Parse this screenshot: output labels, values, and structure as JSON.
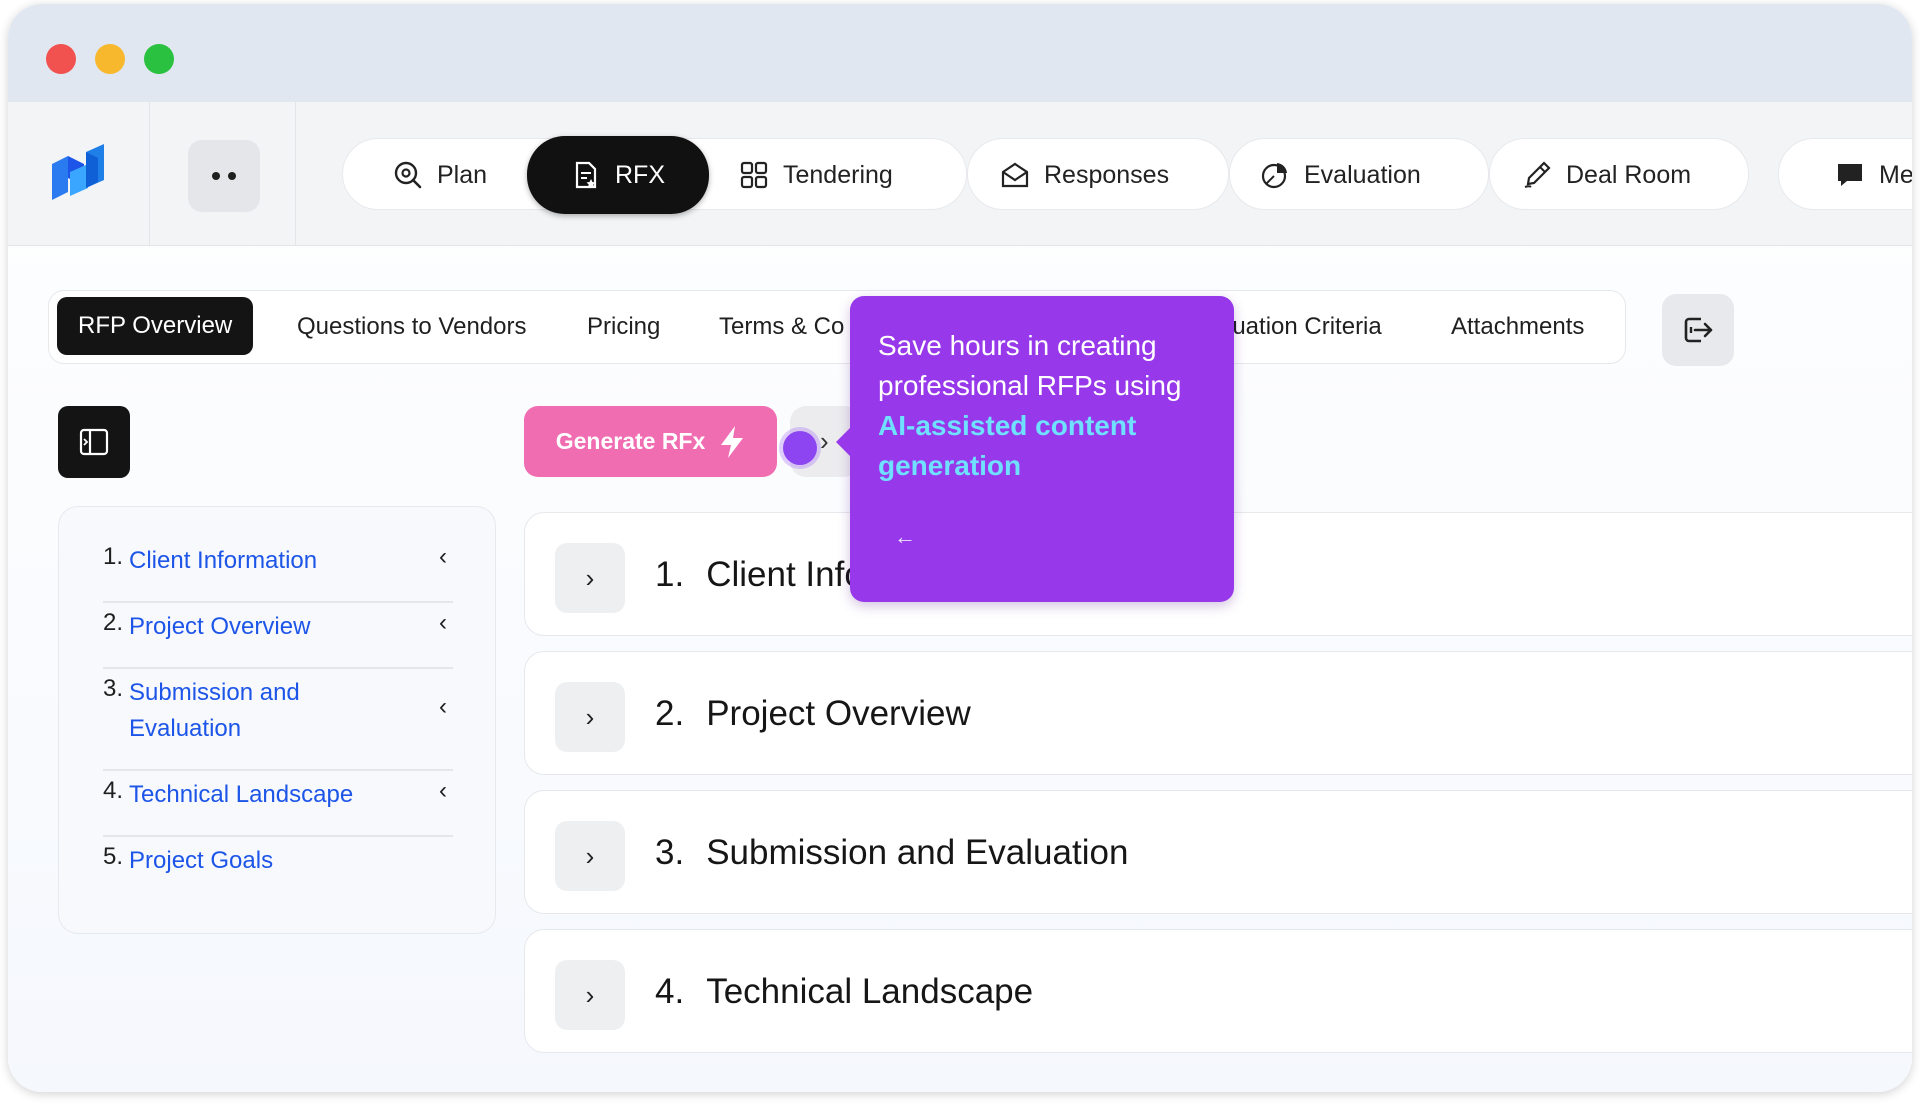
{
  "nav": {
    "items": [
      {
        "label": "Plan",
        "icon": "search-eye-icon"
      },
      {
        "label": "RFX",
        "icon": "document-star-icon",
        "active": true
      },
      {
        "label": "Tendering",
        "icon": "grid-icon"
      },
      {
        "label": "Responses",
        "icon": "envelope-open-icon"
      },
      {
        "label": "Evaluation",
        "icon": "pie-chart-icon"
      },
      {
        "label": "Deal Room",
        "icon": "pen-icon"
      },
      {
        "label": "Mes",
        "icon": "chat-bubble-icon"
      }
    ]
  },
  "subtabs": {
    "items": [
      "RFP Overview",
      "Questions to Vendors",
      "Pricing",
      "Terms & Co",
      "luation Criteria",
      "Attachments"
    ],
    "active_index": 0
  },
  "toolbar": {
    "generate_label": "Generate RFx"
  },
  "outline": {
    "items": [
      {
        "num": "1.",
        "label": "Client Information",
        "chevron": "‹"
      },
      {
        "num": "2.",
        "label": "Project Overview",
        "chevron": "‹"
      },
      {
        "num": "3.",
        "label": "Submission and Evaluation",
        "chevron": "‹"
      },
      {
        "num": "4.",
        "label": "Technical Landscape",
        "chevron": "‹"
      },
      {
        "num": "5.",
        "label": "Project Goals",
        "chevron": ""
      }
    ]
  },
  "sections": [
    {
      "num": "1.",
      "title": "Client Info"
    },
    {
      "num": "2.",
      "title": "Project Overview"
    },
    {
      "num": "3.",
      "title": "Submission and Evaluation"
    },
    {
      "num": "4.",
      "title": "Technical Landscape"
    }
  ],
  "tooltip": {
    "text": "Save hours in creating professional RFPs using",
    "highlight": "AI-assisted content generation",
    "back_arrow": "←"
  },
  "colors": {
    "accent_pink": "#f06db2",
    "tooltip_purple": "#9739ea",
    "link_blue": "#1c55e8",
    "highlight_cyan": "#6fe0ff"
  }
}
